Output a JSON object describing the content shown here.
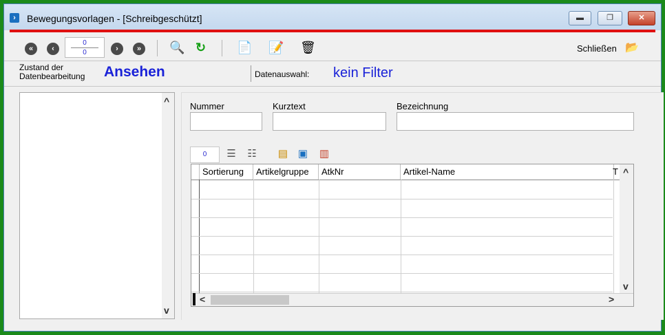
{
  "window": {
    "title": "Bewegungsvorlagen - [Schreibgeschützt]",
    "app_icon": "›"
  },
  "window_buttons": {
    "minimize": "▬",
    "maximize": "❐",
    "close": "✕"
  },
  "toolbar": {
    "nav": {
      "first": "«",
      "prev": "‹",
      "next": "›",
      "last": "»"
    },
    "counter": {
      "current": "0",
      "total": "0"
    },
    "search_glyph": "🔍",
    "refresh_glyph": "↻",
    "new_glyph": "📄",
    "edit_glyph": "📝",
    "delete_glyph": "🗑",
    "close_label": "Schließen",
    "close_glyph": "📂"
  },
  "status": {
    "state_label_line1": "Zustand der",
    "state_label_line2": "Datenbearbeitung",
    "state_value": "Ansehen",
    "filter_label": "Datenauswahl:",
    "filter_value": "kein Filter"
  },
  "form": {
    "nummer_label": "Nummer",
    "nummer_value": "",
    "kurztext_label": "Kurztext",
    "kurztext_value": "",
    "bezeichnung_label": "Bezeichnung",
    "bezeichnung_value": ""
  },
  "grid_toolbar": {
    "count": "0"
  },
  "grid": {
    "columns": [
      "Sortierung",
      "Artikelgruppe",
      "AtkNr",
      "Artikel-Name",
      "T"
    ]
  },
  "scroll": {
    "up": "^",
    "down": "v",
    "left": "<",
    "right": ">"
  },
  "colors": {
    "accent_blue": "#1a22d8",
    "title_red_line": "#e01010",
    "frame_green": "#1b8a1b"
  }
}
